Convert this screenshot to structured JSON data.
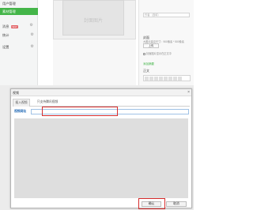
{
  "sidebar": {
    "items": [
      {
        "label": "用户管理",
        "active": false
      },
      {
        "label": "素材管理",
        "active": true
      },
      {
        "label": "消息",
        "badge": "NEW",
        "active": false
      },
      {
        "label": "统计",
        "active": false
      },
      {
        "label": "设置",
        "active": false
      }
    ]
  },
  "editor": {
    "cover_placeholder": "封面图片"
  },
  "right_panel": {
    "author_label": "作者（选填）",
    "cover_label": "封面",
    "cover_size_hint": "大图片建议尺寸：900像素 * 500像素",
    "upload_button": "上传",
    "show_cover_in_body": "封面图片显示在正文中",
    "add_summary_link": "添加摘要",
    "body_label": "正文"
  },
  "dialog": {
    "title": "视频",
    "close_icon": "×",
    "tabs": [
      {
        "label": "插入视频"
      },
      {
        "label": "只支持腾讯视频"
      }
    ],
    "video_url_label": "视频网址",
    "video_url_value": "",
    "confirm_label": "确认",
    "cancel_label": "取消"
  },
  "colors": {
    "accent_green": "#44b549",
    "highlight_red": "#d62d2d",
    "label_blue": "#2a6fb8"
  }
}
